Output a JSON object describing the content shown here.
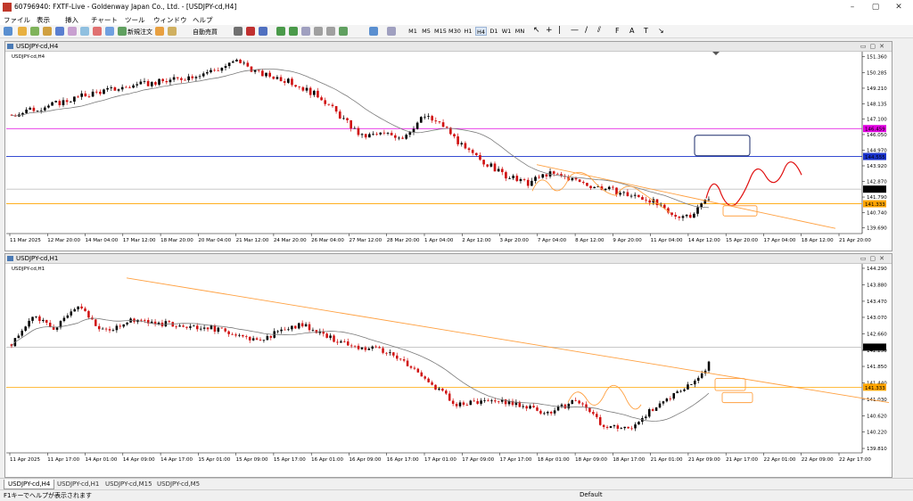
{
  "window": {
    "title": "60796940: FXTF-Live - Goldenway Japan Co., Ltd. - [USDJPY-cd,H4]"
  },
  "menu": [
    "ファイル",
    "表示",
    "挿入",
    "チャート",
    "ツール",
    "ウィンドウ",
    "ヘルプ"
  ],
  "toolbar": {
    "new_order": "新規注文",
    "auto_trading": "自動売買",
    "timeframes": [
      "M1",
      "M5",
      "M15",
      "M30",
      "H1",
      "H4",
      "D1",
      "W1",
      "MN"
    ],
    "active_timeframe": "H4"
  },
  "charts": [
    {
      "window_title": "USDJPY-cd,H4",
      "symbol_label": "USDJPY-cd,H4",
      "price_labels": [
        "151.360",
        "150.285",
        "149.210",
        "148.135",
        "147.100",
        "146.050",
        "144.970",
        "143.920",
        "142.870",
        "141.790",
        "140.740",
        "139.690"
      ],
      "highlighted_prices": [
        {
          "value": "146.459",
          "color": "#e000e0"
        },
        {
          "value": "144.555",
          "color": "#1a33cc"
        },
        {
          "value": "142.329",
          "color": "#000000"
        },
        {
          "value": "141.333",
          "color": "#ffa500"
        }
      ],
      "time_labels": [
        "11 Mar 2025",
        "12 Mar 20:00",
        "14 Mar 04:00",
        "17 Mar 12:00",
        "18 Mar 20:00",
        "20 Mar 04:00",
        "21 Mar 12:00",
        "24 Mar 20:00",
        "26 Mar 04:00",
        "27 Mar 12:00",
        "28 Mar 20:00",
        "1 Apr 04:00",
        "2 Apr 12:00",
        "3 Apr 20:00",
        "7 Apr 04:00",
        "8 Apr 12:00",
        "9 Apr 20:00",
        "11 Apr 04:00",
        "14 Apr 12:00",
        "15 Apr 20:00",
        "17 Apr 04:00",
        "18 Apr 12:00",
        "21 Apr 20:00"
      ]
    },
    {
      "window_title": "USDJPY-cd,H1",
      "symbol_label": "USDJPY-cd,H1",
      "price_labels": [
        "144.290",
        "143.880",
        "143.470",
        "143.070",
        "142.660",
        "142.250",
        "141.850",
        "141.440",
        "141.030",
        "140.620",
        "140.220",
        "139.810"
      ],
      "highlighted_prices": [
        {
          "value": "142.329",
          "color": "#000000"
        },
        {
          "value": "141.333",
          "color": "#ffa500"
        }
      ],
      "time_labels": [
        "11 Apr 2025",
        "11 Apr 17:00",
        "14 Apr 01:00",
        "14 Apr 09:00",
        "14 Apr 17:00",
        "15 Apr 01:00",
        "15 Apr 09:00",
        "15 Apr 17:00",
        "16 Apr 01:00",
        "16 Apr 09:00",
        "16 Apr 17:00",
        "17 Apr 01:00",
        "17 Apr 09:00",
        "17 Apr 17:00",
        "18 Apr 01:00",
        "18 Apr 09:00",
        "18 Apr 17:00",
        "21 Apr 01:00",
        "21 Apr 09:00",
        "21 Apr 17:00",
        "22 Apr 01:00",
        "22 Apr 09:00",
        "22 Apr 17:00"
      ]
    }
  ],
  "tabs": [
    "USDJPY-cd,H4",
    "USDJPY-cd,H1",
    "USDJPY-cd,M15",
    "USDJPY-cd,M5"
  ],
  "status": {
    "help": "F1キーでヘルプが表示されます",
    "profile": "Default"
  },
  "colors": {
    "bull": "#000000",
    "bear": "#d01010",
    "ma": "#7a7a7a",
    "annotation": "#ffa040"
  }
}
